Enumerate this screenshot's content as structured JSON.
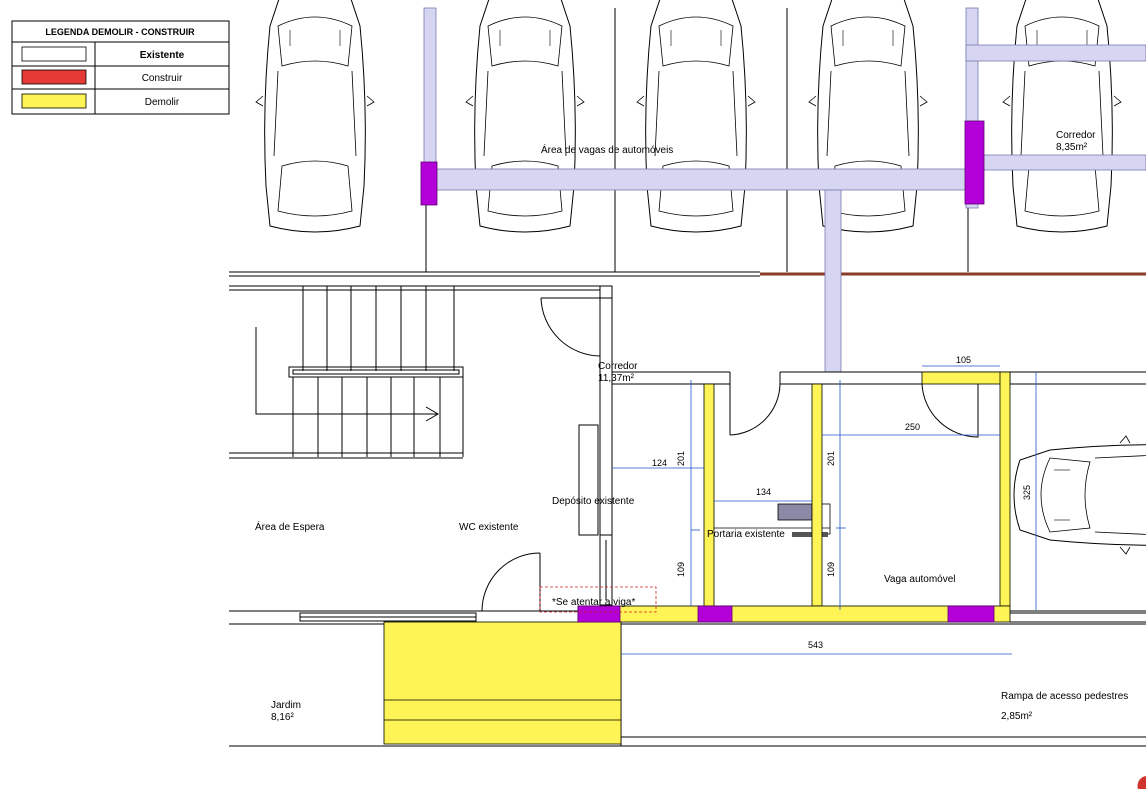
{
  "legend": {
    "title": "LEGENDA DEMOLIR - CONSTRUIR",
    "rows": [
      {
        "label": "Existente",
        "color": "#ffffff"
      },
      {
        "label": "Construir",
        "color": "#e53935"
      },
      {
        "label": "Demolir",
        "color": "#fff455"
      }
    ]
  },
  "rooms": {
    "parking_area": "Área de vagas de automóveis",
    "corridor_top": "Corredor",
    "corridor_top_area": "8,35m²",
    "corridor_mid": "Corredor",
    "corridor_mid_area": "11,37m²",
    "deposito": "Depósito existente",
    "waiting": "Área de Espera",
    "wc": "WC existente",
    "portaria": "Portaria existente",
    "vaga": "Vaga automóvel",
    "beam_note": "*Se atentar a viga*",
    "garden": "Jardim",
    "garden_area": "8,16²",
    "ramp": "Rampa de acesso pedestres",
    "ramp_area": "2,85m²"
  },
  "dimensions": {
    "d105": "105",
    "d250": "250",
    "d124": "124",
    "d201a": "201",
    "d201b": "201",
    "d134": "134",
    "d109a": "109",
    "d109b": "109",
    "d325": "325",
    "d543": "543"
  },
  "colors": {
    "demolish": "#fff455",
    "beam": "#d6d6f2",
    "pillar": "#b400d8",
    "dimension": "#2255cc",
    "wall": "#000000",
    "note_border": "#cc2222",
    "construct_line": "#8b3a2a"
  }
}
